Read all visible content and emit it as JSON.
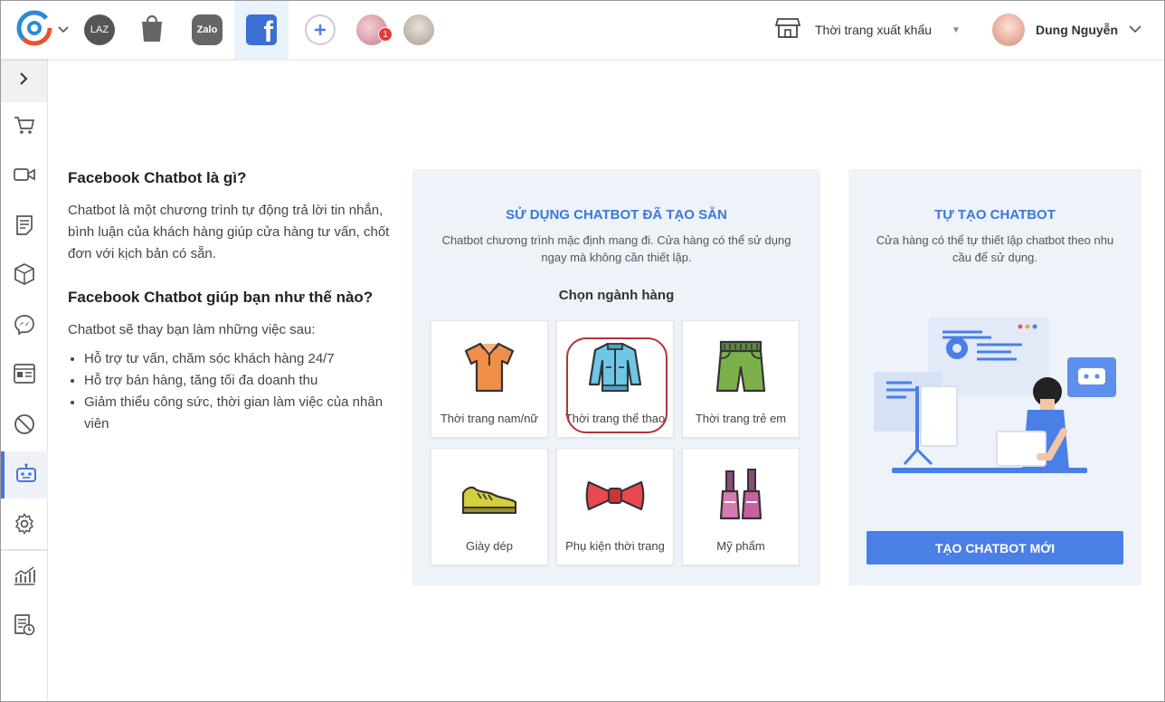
{
  "topbar": {
    "channels": [
      {
        "name": "Lazada",
        "label": "LAZ"
      },
      {
        "name": "Shopee",
        "label": "S"
      },
      {
        "name": "Zalo",
        "label": "Zalo"
      },
      {
        "name": "Facebook",
        "label": "f",
        "active": true
      }
    ],
    "notification_count": "1",
    "shop_name": "Thời trang xuất khẩu",
    "user_name": "Dung Nguyễn"
  },
  "sidebar": {
    "items": [
      "cart-icon",
      "video-icon",
      "document-icon",
      "box-icon",
      "messenger-icon",
      "contact-card-icon",
      "block-icon",
      "chatbot-icon",
      "settings-icon",
      "chart-icon",
      "report-icon"
    ],
    "active_item": "chatbot-icon"
  },
  "intro": {
    "q1": "Facebook Chatbot là gì?",
    "a1": "Chatbot là một chương trình tự động trả lời tin nhắn, bình luận của khách hàng giúp cửa hàng tư vấn, chốt đơn với kịch bản có sẵn.",
    "q2": "Facebook Chatbot giúp bạn như thế nào?",
    "a2": "Chatbot sẽ thay bạn làm những việc sau:",
    "bullets": [
      "Hỗ trợ tư vấn, chăm sóc khách hàng 24/7",
      "Hỗ trợ bán hàng, tăng tối đa doanh thu",
      "Giảm thiểu công sức, thời gian làm việc của nhân viên"
    ]
  },
  "prebuilt": {
    "title": "SỬ DỤNG CHATBOT ĐÃ TẠO SẴN",
    "desc": "Chatbot chương trình mặc định mang đi. Cửa hàng có thể sử dụng ngay mà không cần thiết lập.",
    "category_title": "Chọn ngành hàng",
    "categories": [
      {
        "label": "Thời trang nam/nữ",
        "icon": "polo-shirt-icon"
      },
      {
        "label": "Thời trang thể thao",
        "icon": "sport-jacket-icon"
      },
      {
        "label": "Thời trang trẻ em",
        "icon": "kids-shorts-icon"
      },
      {
        "label": "Giày dép",
        "icon": "sneaker-icon"
      },
      {
        "label": "Phụ kiện thời trang",
        "icon": "bow-tie-icon"
      },
      {
        "label": "Mỹ phẩm",
        "icon": "nail-polish-icon"
      }
    ],
    "selected_category": "Thời trang thể thao"
  },
  "custom": {
    "title": "TỰ TẠO CHATBOT",
    "desc": "Cửa hàng có thể tự thiết lập chatbot theo nhu cầu để sử dụng.",
    "button_label": "TẠO CHATBOT MỚI"
  },
  "colors": {
    "accent": "#3b79d8",
    "button": "#4a7fe6",
    "panel_bg": "#eef2f9",
    "highlight": "#b5323a",
    "badge": "#e53935"
  }
}
